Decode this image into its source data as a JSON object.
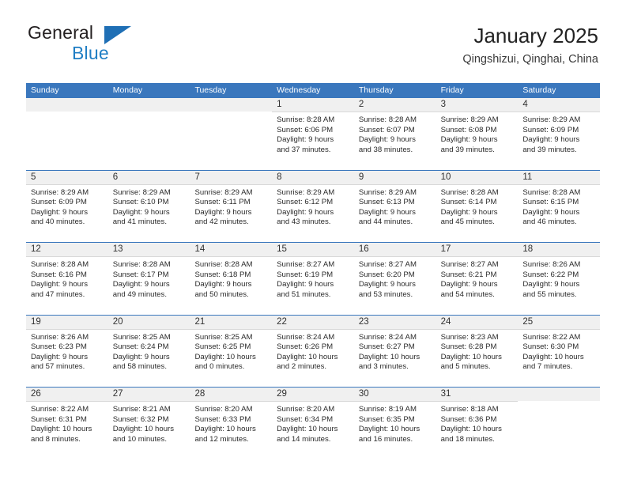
{
  "brand": {
    "word_one": "General",
    "word_two": "Blue",
    "accent_color": "#1f7ec4",
    "triangle_color": "#1f6fb5"
  },
  "header": {
    "title": "January 2025",
    "location": "Qingshizui, Qinghai, China",
    "header_bg_color": "#3a77bd",
    "row_divider_color": "#3a77bd",
    "daynum_band_color": "#f0f0f0"
  },
  "weekday_headers": [
    "Sunday",
    "Monday",
    "Tuesday",
    "Wednesday",
    "Thursday",
    "Friday",
    "Saturday"
  ],
  "weeks": [
    [
      {
        "day": "",
        "empty": true,
        "sunrise": "",
        "sunset": "",
        "daylight_1": "",
        "daylight_2": ""
      },
      {
        "day": "",
        "empty": true,
        "sunrise": "",
        "sunset": "",
        "daylight_1": "",
        "daylight_2": ""
      },
      {
        "day": "",
        "empty": true,
        "sunrise": "",
        "sunset": "",
        "daylight_1": "",
        "daylight_2": ""
      },
      {
        "day": "1",
        "empty": false,
        "sunrise": "Sunrise: 8:28 AM",
        "sunset": "Sunset: 6:06 PM",
        "daylight_1": "Daylight: 9 hours",
        "daylight_2": "and 37 minutes."
      },
      {
        "day": "2",
        "empty": false,
        "sunrise": "Sunrise: 8:28 AM",
        "sunset": "Sunset: 6:07 PM",
        "daylight_1": "Daylight: 9 hours",
        "daylight_2": "and 38 minutes."
      },
      {
        "day": "3",
        "empty": false,
        "sunrise": "Sunrise: 8:29 AM",
        "sunset": "Sunset: 6:08 PM",
        "daylight_1": "Daylight: 9 hours",
        "daylight_2": "and 39 minutes."
      },
      {
        "day": "4",
        "empty": false,
        "sunrise": "Sunrise: 8:29 AM",
        "sunset": "Sunset: 6:09 PM",
        "daylight_1": "Daylight: 9 hours",
        "daylight_2": "and 39 minutes."
      }
    ],
    [
      {
        "day": "5",
        "empty": false,
        "sunrise": "Sunrise: 8:29 AM",
        "sunset": "Sunset: 6:09 PM",
        "daylight_1": "Daylight: 9 hours",
        "daylight_2": "and 40 minutes."
      },
      {
        "day": "6",
        "empty": false,
        "sunrise": "Sunrise: 8:29 AM",
        "sunset": "Sunset: 6:10 PM",
        "daylight_1": "Daylight: 9 hours",
        "daylight_2": "and 41 minutes."
      },
      {
        "day": "7",
        "empty": false,
        "sunrise": "Sunrise: 8:29 AM",
        "sunset": "Sunset: 6:11 PM",
        "daylight_1": "Daylight: 9 hours",
        "daylight_2": "and 42 minutes."
      },
      {
        "day": "8",
        "empty": false,
        "sunrise": "Sunrise: 8:29 AM",
        "sunset": "Sunset: 6:12 PM",
        "daylight_1": "Daylight: 9 hours",
        "daylight_2": "and 43 minutes."
      },
      {
        "day": "9",
        "empty": false,
        "sunrise": "Sunrise: 8:29 AM",
        "sunset": "Sunset: 6:13 PM",
        "daylight_1": "Daylight: 9 hours",
        "daylight_2": "and 44 minutes."
      },
      {
        "day": "10",
        "empty": false,
        "sunrise": "Sunrise: 8:28 AM",
        "sunset": "Sunset: 6:14 PM",
        "daylight_1": "Daylight: 9 hours",
        "daylight_2": "and 45 minutes."
      },
      {
        "day": "11",
        "empty": false,
        "sunrise": "Sunrise: 8:28 AM",
        "sunset": "Sunset: 6:15 PM",
        "daylight_1": "Daylight: 9 hours",
        "daylight_2": "and 46 minutes."
      }
    ],
    [
      {
        "day": "12",
        "empty": false,
        "sunrise": "Sunrise: 8:28 AM",
        "sunset": "Sunset: 6:16 PM",
        "daylight_1": "Daylight: 9 hours",
        "daylight_2": "and 47 minutes."
      },
      {
        "day": "13",
        "empty": false,
        "sunrise": "Sunrise: 8:28 AM",
        "sunset": "Sunset: 6:17 PM",
        "daylight_1": "Daylight: 9 hours",
        "daylight_2": "and 49 minutes."
      },
      {
        "day": "14",
        "empty": false,
        "sunrise": "Sunrise: 8:28 AM",
        "sunset": "Sunset: 6:18 PM",
        "daylight_1": "Daylight: 9 hours",
        "daylight_2": "and 50 minutes."
      },
      {
        "day": "15",
        "empty": false,
        "sunrise": "Sunrise: 8:27 AM",
        "sunset": "Sunset: 6:19 PM",
        "daylight_1": "Daylight: 9 hours",
        "daylight_2": "and 51 minutes."
      },
      {
        "day": "16",
        "empty": false,
        "sunrise": "Sunrise: 8:27 AM",
        "sunset": "Sunset: 6:20 PM",
        "daylight_1": "Daylight: 9 hours",
        "daylight_2": "and 53 minutes."
      },
      {
        "day": "17",
        "empty": false,
        "sunrise": "Sunrise: 8:27 AM",
        "sunset": "Sunset: 6:21 PM",
        "daylight_1": "Daylight: 9 hours",
        "daylight_2": "and 54 minutes."
      },
      {
        "day": "18",
        "empty": false,
        "sunrise": "Sunrise: 8:26 AM",
        "sunset": "Sunset: 6:22 PM",
        "daylight_1": "Daylight: 9 hours",
        "daylight_2": "and 55 minutes."
      }
    ],
    [
      {
        "day": "19",
        "empty": false,
        "sunrise": "Sunrise: 8:26 AM",
        "sunset": "Sunset: 6:23 PM",
        "daylight_1": "Daylight: 9 hours",
        "daylight_2": "and 57 minutes."
      },
      {
        "day": "20",
        "empty": false,
        "sunrise": "Sunrise: 8:25 AM",
        "sunset": "Sunset: 6:24 PM",
        "daylight_1": "Daylight: 9 hours",
        "daylight_2": "and 58 minutes."
      },
      {
        "day": "21",
        "empty": false,
        "sunrise": "Sunrise: 8:25 AM",
        "sunset": "Sunset: 6:25 PM",
        "daylight_1": "Daylight: 10 hours",
        "daylight_2": "and 0 minutes."
      },
      {
        "day": "22",
        "empty": false,
        "sunrise": "Sunrise: 8:24 AM",
        "sunset": "Sunset: 6:26 PM",
        "daylight_1": "Daylight: 10 hours",
        "daylight_2": "and 2 minutes."
      },
      {
        "day": "23",
        "empty": false,
        "sunrise": "Sunrise: 8:24 AM",
        "sunset": "Sunset: 6:27 PM",
        "daylight_1": "Daylight: 10 hours",
        "daylight_2": "and 3 minutes."
      },
      {
        "day": "24",
        "empty": false,
        "sunrise": "Sunrise: 8:23 AM",
        "sunset": "Sunset: 6:28 PM",
        "daylight_1": "Daylight: 10 hours",
        "daylight_2": "and 5 minutes."
      },
      {
        "day": "25",
        "empty": false,
        "sunrise": "Sunrise: 8:22 AM",
        "sunset": "Sunset: 6:30 PM",
        "daylight_1": "Daylight: 10 hours",
        "daylight_2": "and 7 minutes."
      }
    ],
    [
      {
        "day": "26",
        "empty": false,
        "sunrise": "Sunrise: 8:22 AM",
        "sunset": "Sunset: 6:31 PM",
        "daylight_1": "Daylight: 10 hours",
        "daylight_2": "and 8 minutes."
      },
      {
        "day": "27",
        "empty": false,
        "sunrise": "Sunrise: 8:21 AM",
        "sunset": "Sunset: 6:32 PM",
        "daylight_1": "Daylight: 10 hours",
        "daylight_2": "and 10 minutes."
      },
      {
        "day": "28",
        "empty": false,
        "sunrise": "Sunrise: 8:20 AM",
        "sunset": "Sunset: 6:33 PM",
        "daylight_1": "Daylight: 10 hours",
        "daylight_2": "and 12 minutes."
      },
      {
        "day": "29",
        "empty": false,
        "sunrise": "Sunrise: 8:20 AM",
        "sunset": "Sunset: 6:34 PM",
        "daylight_1": "Daylight: 10 hours",
        "daylight_2": "and 14 minutes."
      },
      {
        "day": "30",
        "empty": false,
        "sunrise": "Sunrise: 8:19 AM",
        "sunset": "Sunset: 6:35 PM",
        "daylight_1": "Daylight: 10 hours",
        "daylight_2": "and 16 minutes."
      },
      {
        "day": "31",
        "empty": false,
        "sunrise": "Sunrise: 8:18 AM",
        "sunset": "Sunset: 6:36 PM",
        "daylight_1": "Daylight: 10 hours",
        "daylight_2": "and 18 minutes."
      },
      {
        "day": "",
        "empty": true,
        "sunrise": "",
        "sunset": "",
        "daylight_1": "",
        "daylight_2": ""
      }
    ]
  ]
}
